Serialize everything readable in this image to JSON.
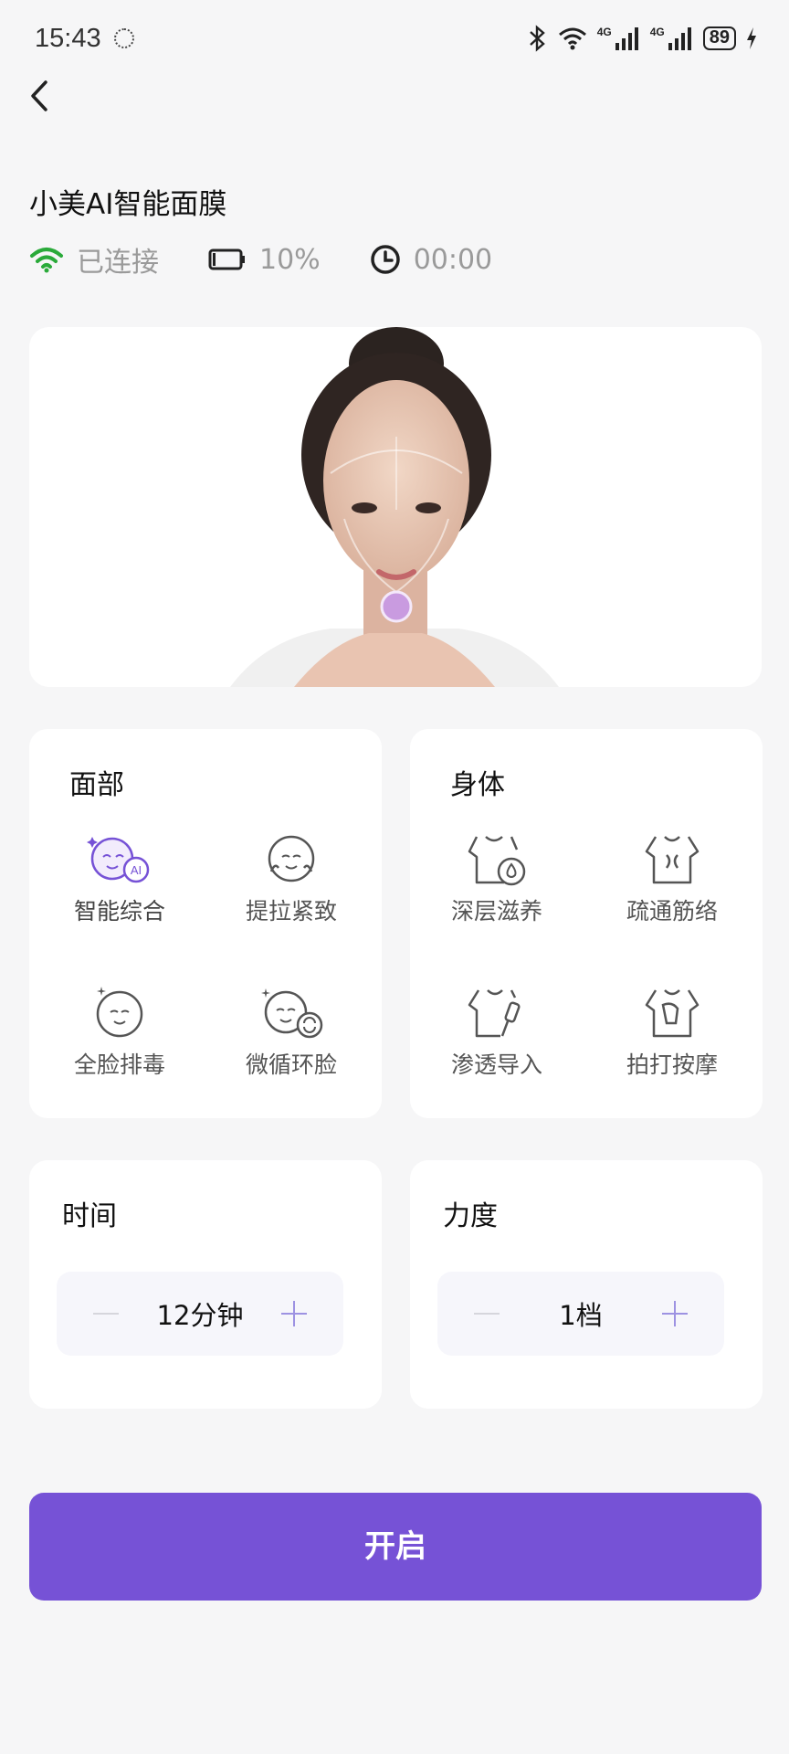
{
  "status_bar": {
    "time": "15:43",
    "network_1": "4G",
    "network_2": "4G",
    "battery": "89"
  },
  "header": {
    "back_icon": "chevron-left-icon",
    "device_name": "小美AI智能面膜"
  },
  "device_info": {
    "connection": "已连接",
    "battery": "10%",
    "timer": "00:00",
    "connected_color": "#2aaa3a"
  },
  "face_section": {
    "title": "面部",
    "items": [
      {
        "label": "智能综合",
        "icon": "ai-face-icon",
        "selected": true
      },
      {
        "label": "提拉紧致",
        "icon": "face-lift-icon"
      },
      {
        "label": "全脸排毒",
        "icon": "face-detox-icon"
      },
      {
        "label": "微循环脸",
        "icon": "face-circulation-icon"
      }
    ]
  },
  "body_section": {
    "title": "身体",
    "items": [
      {
        "label": "深层滋养",
        "icon": "body-nourish-icon"
      },
      {
        "label": "疏通筋络",
        "icon": "body-meridian-icon"
      },
      {
        "label": "渗透导入",
        "icon": "body-infuse-icon"
      },
      {
        "label": "拍打按摩",
        "icon": "body-massage-icon"
      }
    ]
  },
  "time_setting": {
    "title": "时间",
    "value": "12分钟"
  },
  "strength_setting": {
    "title": "力度",
    "value": "1档"
  },
  "start_button": {
    "label": "开启"
  },
  "colors": {
    "accent": "#7652d6",
    "background": "#f6f6f7"
  }
}
